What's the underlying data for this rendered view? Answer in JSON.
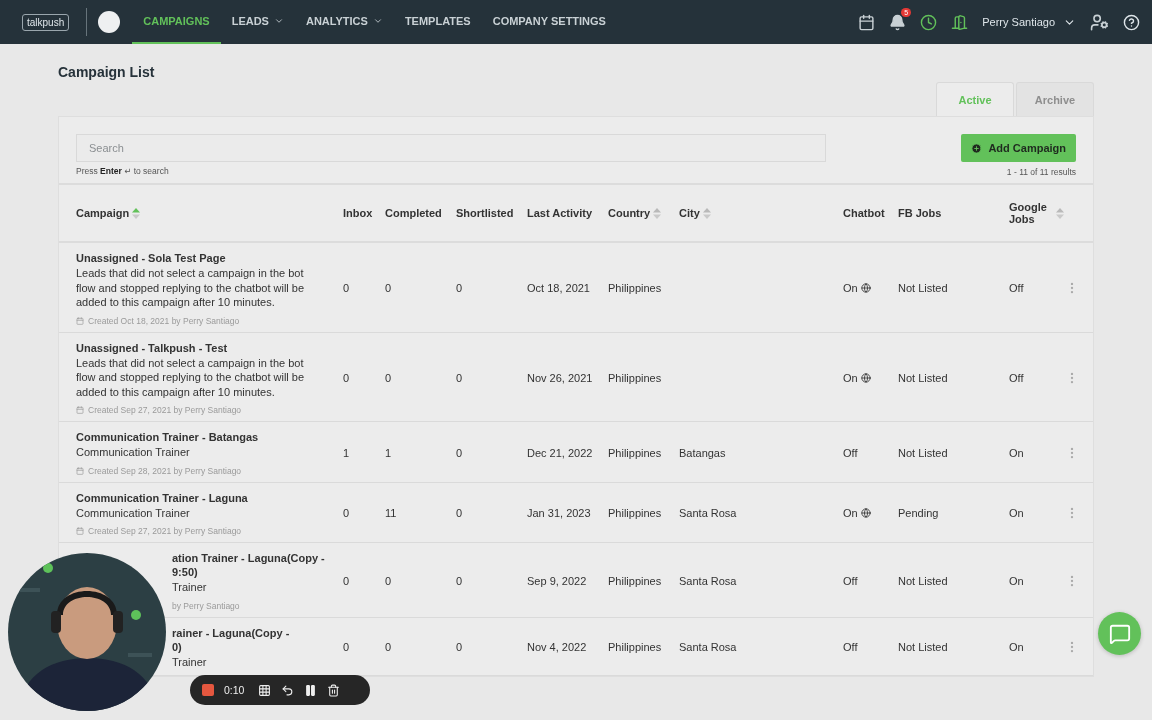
{
  "nav": {
    "logo": "talkpush",
    "items": [
      {
        "label": "CAMPAIGNS",
        "selected": true,
        "dropdown": false
      },
      {
        "label": "LEADS",
        "selected": false,
        "dropdown": true
      },
      {
        "label": "ANALYTICS",
        "selected": false,
        "dropdown": true
      },
      {
        "label": "TEMPLATES",
        "selected": false,
        "dropdown": false
      },
      {
        "label": "COMPANY SETTINGS",
        "selected": false,
        "dropdown": false
      }
    ],
    "notifications": "5",
    "user": "Perry Santiago"
  },
  "page_title": "Campaign List",
  "tabs": [
    {
      "label": "Active",
      "selected": true
    },
    {
      "label": "Archive",
      "selected": false
    }
  ],
  "search": {
    "placeholder": "Search",
    "hint": "Press **Enter** ↵ to search"
  },
  "add_button": "Add Campaign",
  "results": "1 - 11 of 11 results",
  "columns": [
    {
      "label": "Campaign",
      "sorted": true
    },
    {
      "label": "Inbox"
    },
    {
      "label": "Completed"
    },
    {
      "label": "Shortlisted"
    },
    {
      "label": "Last Activity"
    },
    {
      "label": "Country",
      "sorted": false
    },
    {
      "label": "City",
      "sorted": false
    },
    {
      "label": "Chatbot"
    },
    {
      "label": "FB Jobs"
    },
    {
      "label": "Google Jobs",
      "sorted": false
    }
  ],
  "rows": [
    {
      "title": "Unassigned - Sola Test Page",
      "description": "Leads that did not select a campaign in the bot flow and stopped replying to the chatbot will be added to this campaign after 10 minutes.",
      "created": "Created Oct 18, 2021 by Perry Santiago",
      "clipped": false,
      "inbox": "0",
      "completed": "0",
      "shortlisted": "0",
      "last_activity": "Oct 18, 2021",
      "country": "Philippines",
      "chatbot": "On",
      "chatbot_globe": true,
      "fb_jobs": "Not Listed",
      "google_jobs": "Off"
    },
    {
      "title": "Unassigned - Talkpush - Test",
      "description": "Leads that did not select a campaign in the bot flow and stopped replying to the chatbot will be added to this campaign after 10 minutes.",
      "created": "Created Sep 27, 2021 by Perry Santiago",
      "clipped": false,
      "inbox": "0",
      "completed": "0",
      "shortlisted": "0",
      "last_activity": "Nov 26, 2021",
      "country": "Philippines",
      "chatbot": "On",
      "chatbot_globe": true,
      "fb_jobs": "Not Listed",
      "google_jobs": "Off"
    },
    {
      "title": "Communication Trainer - Batangas",
      "description": "Communication Trainer",
      "created": "Created Sep 28, 2021 by Perry Santiago",
      "clipped": false,
      "inbox": "1",
      "completed": "1",
      "shortlisted": "0",
      "last_activity": "Dec 21, 2022",
      "country": "Philippines",
      "city": "Batangas",
      "chatbot": "Off",
      "chatbot_globe": false,
      "fb_jobs": "Not Listed",
      "google_jobs": "On"
    },
    {
      "title": "Communication Trainer - Laguna",
      "description": "Communication Trainer",
      "created": "Created Sep 27, 2021 by Perry Santiago",
      "clipped": false,
      "inbox": "0",
      "completed": "11",
      "shortlisted": "0",
      "last_activity": "Jan 31, 2023",
      "country": "Philippines",
      "city": "Santa Rosa",
      "chatbot": "On",
      "chatbot_globe": true,
      "fb_jobs": "Pending",
      "google_jobs": "On"
    },
    {
      "title": "ation Trainer - Laguna(Copy -\n9:50)",
      "description": "Trainer",
      "created": "by Perry Santiago",
      "clipped": true,
      "inbox": "0",
      "completed": "0",
      "shortlisted": "0",
      "last_activity": "Sep 9, 2022",
      "country": "Philippines",
      "city": "Santa Rosa",
      "chatbot": "Off",
      "chatbot_globe": false,
      "fb_jobs": "Not Listed",
      "google_jobs": "On"
    },
    {
      "title": "rainer - Laguna(Copy -\n0)",
      "description": "Trainer",
      "clipped": true,
      "inbox": "0",
      "completed": "0",
      "shortlisted": "0",
      "last_activity": "Nov 4, 2022",
      "country": "Philippines",
      "city": "Santa Rosa",
      "chatbot": "Off",
      "chatbot_globe": false,
      "fb_jobs": "Not Listed",
      "google_jobs": "On"
    }
  ],
  "recorder": {
    "time": "0:10"
  }
}
